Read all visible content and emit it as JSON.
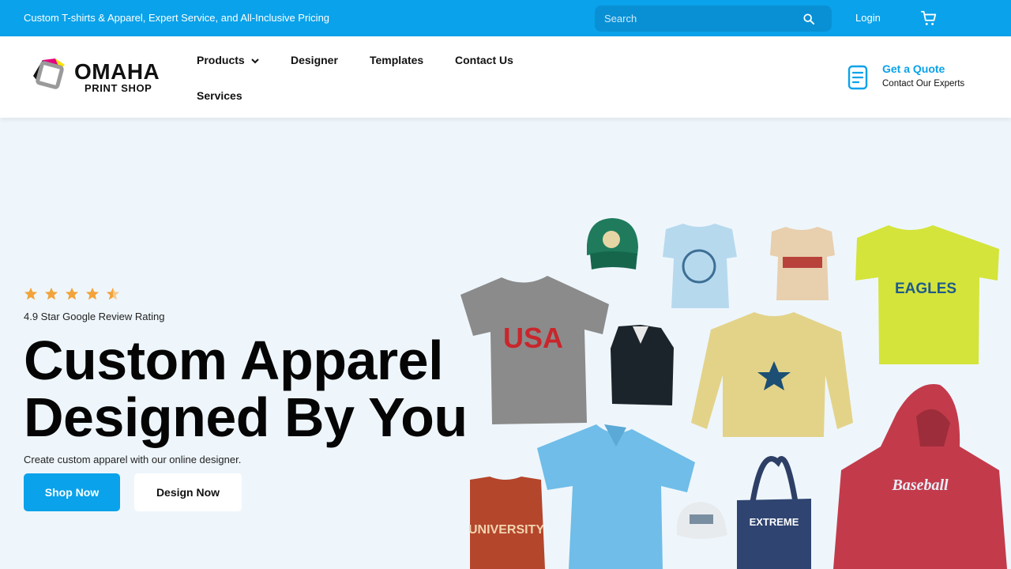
{
  "topbar": {
    "promo": "Custom T-shirts & Apparel, Expert Service, and All-Inclusive Pricing",
    "search_placeholder": "Search",
    "login_label": "Login",
    "search_icon": "search-icon",
    "cart_icon": "cart-icon"
  },
  "header": {
    "logo": {
      "line1": "OMAHA",
      "line2": "PRINT SHOP"
    },
    "nav": [
      {
        "label": "Products",
        "has_dropdown": true
      },
      {
        "label": "Designer"
      },
      {
        "label": "Templates"
      },
      {
        "label": "Contact Us"
      },
      {
        "label": "Services"
      }
    ],
    "quote": {
      "title": "Get a Quote",
      "subtitle": "Contact Our Experts",
      "icon": "document-icon"
    }
  },
  "hero": {
    "rating_stars": 4.9,
    "rating_text": "4.9 Star Google Review Rating",
    "title_line1": "Custom Apparel",
    "title_line2": "Designed By You",
    "subtitle": "Create custom apparel with our online designer.",
    "primary_button": "Shop Now",
    "secondary_button": "Design Now"
  },
  "colors": {
    "brand": "#0aa2ea",
    "hero_background": "#eef6fc",
    "star": "#f2a33a"
  }
}
